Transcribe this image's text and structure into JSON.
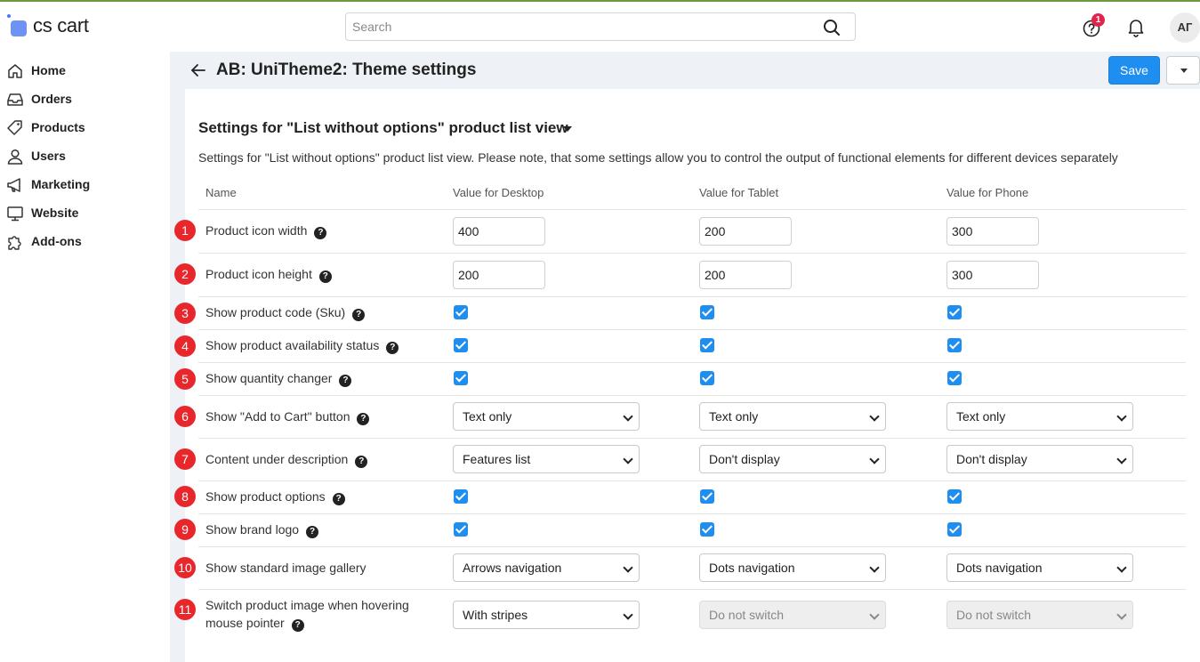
{
  "brand": {
    "name": "cs cart"
  },
  "search": {
    "placeholder": "Search"
  },
  "header": {
    "notification_count": "1",
    "avatar_initials": "АГ"
  },
  "sidebar": {
    "items": [
      {
        "label": "Home",
        "icon": "home-icon"
      },
      {
        "label": "Orders",
        "icon": "inbox-icon"
      },
      {
        "label": "Products",
        "icon": "tag-icon"
      },
      {
        "label": "Users",
        "icon": "user-icon"
      },
      {
        "label": "Marketing",
        "icon": "megaphone-icon"
      },
      {
        "label": "Website",
        "icon": "monitor-icon"
      },
      {
        "label": "Add-ons",
        "icon": "puzzle-icon"
      }
    ]
  },
  "page": {
    "title": "AB: UniTheme2: Theme settings",
    "save_label": "Save"
  },
  "section": {
    "title": "Settings for \"List without options\" product list view",
    "description": "Settings for \"List without options\" product list view. Please note, that some settings allow you to control the output of functional elements for different devices separately"
  },
  "table": {
    "headers": {
      "name": "Name",
      "desktop": "Value for Desktop",
      "tablet": "Value for Tablet",
      "phone": "Value for Phone"
    },
    "rows": [
      {
        "num": "1",
        "label": "Product icon width",
        "desktop": "400",
        "tablet": "200",
        "phone": "300"
      },
      {
        "num": "2",
        "label": "Product icon height",
        "desktop": "200",
        "tablet": "200",
        "phone": "300"
      },
      {
        "num": "3",
        "label": "Show product code (Sku)"
      },
      {
        "num": "4",
        "label": "Show product availability status"
      },
      {
        "num": "5",
        "label": "Show quantity changer"
      },
      {
        "num": "6",
        "label": "Show \"Add to Cart\" button",
        "desktop": "Text only",
        "tablet": "Text only",
        "phone": "Text only"
      },
      {
        "num": "7",
        "label": "Content under description",
        "desktop": "Features list",
        "tablet": "Don't display",
        "phone": "Don't display"
      },
      {
        "num": "8",
        "label": "Show product options"
      },
      {
        "num": "9",
        "label": "Show brand logo"
      },
      {
        "num": "10",
        "label": "Show standard image gallery",
        "desktop": "Arrows navigation",
        "tablet": "Dots navigation",
        "phone": "Dots navigation"
      },
      {
        "num": "11",
        "label_line1": "Switch product image when hovering",
        "label_line2": "mouse pointer",
        "desktop": "With stripes",
        "tablet": "Do not switch",
        "phone": "Do not switch"
      }
    ]
  },
  "colors": {
    "accent": "#1f8ef1",
    "marker": "#e8272c",
    "topbar_stripe": "#6a9a3c"
  }
}
